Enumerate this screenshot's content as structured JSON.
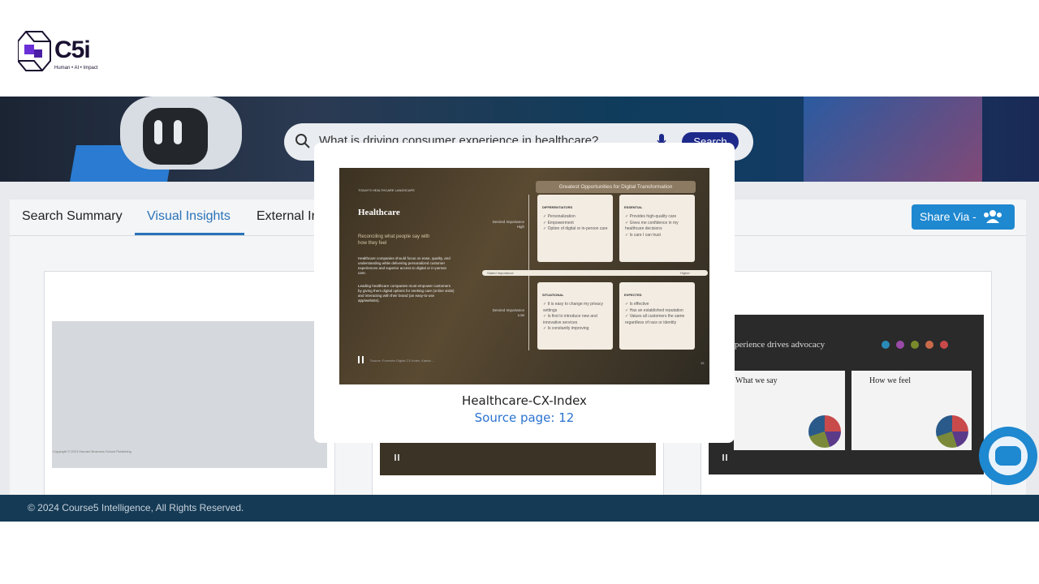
{
  "logo": {
    "text": "C5i",
    "tagline": "Human • AI • Impact"
  },
  "search": {
    "query": "What is driving consumer experience in healthcare?",
    "button_label": "Search"
  },
  "tabs": [
    {
      "label": "Search Summary"
    },
    {
      "label": "Visual Insights",
      "active": true
    },
    {
      "label": "External Ir"
    }
  ],
  "share": {
    "label": "Share Via -"
  },
  "thumbnails": {
    "left_footer": "Copyright © 2021 Harvard Business School Publishing",
    "right_title": "perience drives advocacy",
    "right_box1_title": "What we say",
    "right_box2_title": "How we feel"
  },
  "modal": {
    "title": "Healthcare-CX-Index",
    "source_link": "Source page: 12",
    "slide": {
      "eyebrow": "TODAY'S HEALTHCARE LANDSCAPE",
      "heading": "Healthcare",
      "subheading": "Reconciling what people say with how they feel",
      "body1": "Healthcare companies should focus on ease, quality, and understanding while delivering personalized customer experiences and superior access to digital or in-person care.",
      "body2": "Leading healthcare companies must empower customers by giving them digital options for seeking care (online visits) and interacting with their brand (an easy-to-use app/website).",
      "grid_title": "Greatest Opportunities for Digital Transformation",
      "axis_high": "Desired Importance High",
      "axis_low": "Desired Importance Low",
      "axis_stated": "Stated Importance",
      "axis_higher": "Higher",
      "quadrants": [
        {
          "title": "DIFFERENTIATORS",
          "items": [
            "Personalization",
            "Empowerment",
            "Option of digital or in-person care"
          ]
        },
        {
          "title": "ESSENTIAL",
          "items": [
            "Provides high-quality care",
            "Gives me confidence in my healthcare decisions",
            "Is care I can trust"
          ]
        },
        {
          "title": "SITUATIONAL",
          "items": [
            "It is easy to change my privacy settings",
            "Is first to introduce new and innovative services",
            "Is constantly improving"
          ]
        },
        {
          "title": "EXPECTED",
          "items": [
            "Is effective",
            "Has an established reputation",
            "Values all customers the same regardless of race or identity"
          ]
        }
      ],
      "footer": "Source: Forrester Digital CX Index, Kantar ...",
      "page_number": "12"
    }
  },
  "footer": {
    "text": "© 2024 Course5 Intelligence, All Rights Reserved."
  },
  "colors": {
    "accent": "#2a73b8",
    "share_button": "#1e88d0",
    "footer_bg": "#153a55",
    "search_button": "#1e2a8a"
  }
}
